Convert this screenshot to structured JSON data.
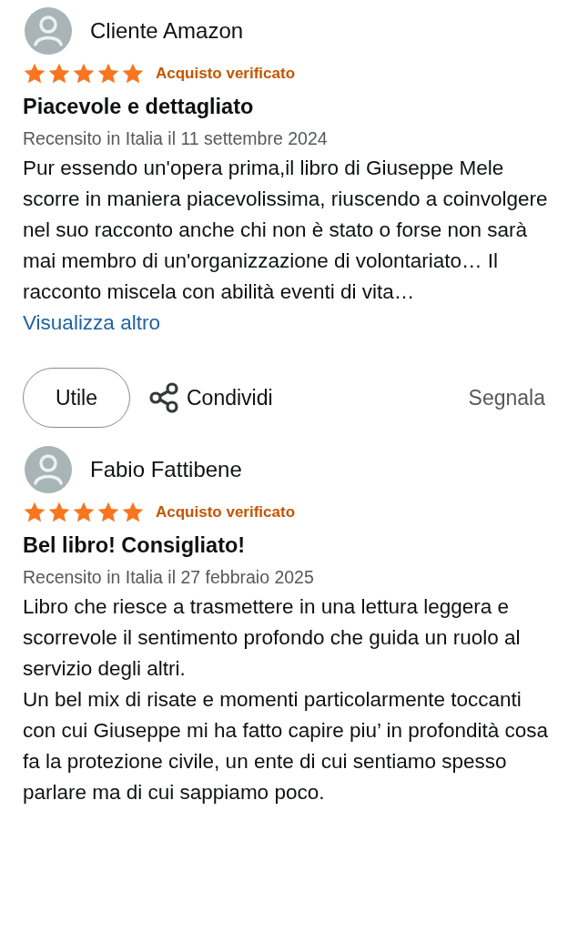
{
  "reviews": [
    {
      "author": "Cliente Amazon",
      "stars": 5,
      "badge": "Acquisto verificato",
      "title": "Piacevole e dettagliato",
      "date": "Recensito in Italia il 11 settembre 2024",
      "body": "Pur essendo un'opera prima,il libro di Giuseppe Mele scorre in maniera piacevolissima, riuscendo a coinvolgere nel suo racconto anche chi non è stato o forse non sarà mai membro di un'organizzazione di volontariato… Il racconto miscela con abilità eventi di vita…",
      "more": "Visualizza altro",
      "actions": {
        "helpful": "Utile",
        "share": "Condividi",
        "report": "Segnala"
      }
    },
    {
      "author": "Fabio Fattibene",
      "stars": 5,
      "badge": "Acquisto verificato",
      "title": "Bel libro! Consigliato!",
      "date": "Recensito in Italia il 27 febbraio 2025",
      "body": "Libro che riesce a trasmettere in una lettura leggera e scorrevole il sentimento profondo che guida un ruolo al servizio degli altri.\nUn bel mix di risate e momenti particolarmente toccanti con cui Giuseppe mi ha fatto capire piu’ in profondità cosa fa la protezione civile, un ente di cui sentiamo spesso parlare ma di cui sappiamo poco."
    }
  ]
}
